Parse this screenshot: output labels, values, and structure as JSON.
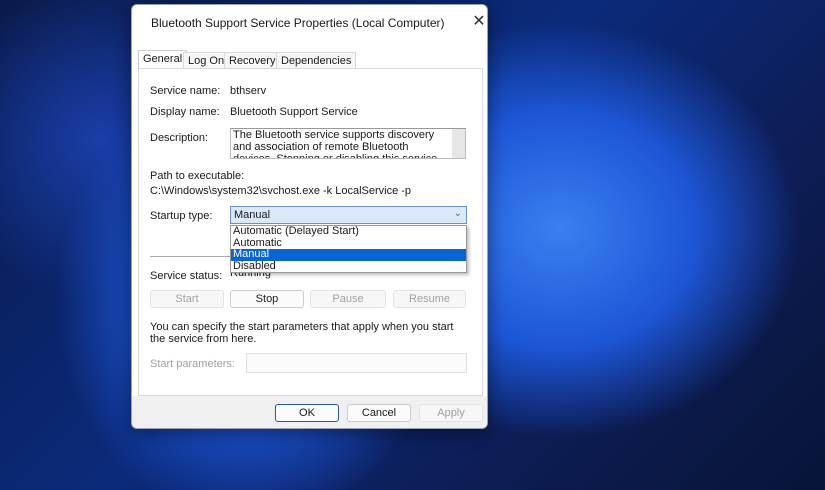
{
  "dialog": {
    "title": "Bluetooth Support Service Properties (Local Computer)",
    "tabs": [
      "General",
      "Log On",
      "Recovery",
      "Dependencies"
    ],
    "service_name_label": "Service name:",
    "service_name": "bthserv",
    "display_name_label": "Display name:",
    "display_name": "Bluetooth Support Service",
    "description_label": "Description:",
    "description": "The Bluetooth service supports discovery and association of remote Bluetooth devices.  Stopping or disabling this service may cause already installed",
    "path_label": "Path to executable:",
    "path": "C:\\Windows\\system32\\svchost.exe -k LocalService -p",
    "startup_label": "Startup type:",
    "startup_value": "Manual",
    "startup_options": [
      "Automatic (Delayed Start)",
      "Automatic",
      "Manual",
      "Disabled"
    ],
    "status_label": "Service status:",
    "status": "Running",
    "buttons": {
      "start": "Start",
      "stop": "Stop",
      "pause": "Pause",
      "resume": "Resume"
    },
    "hint": "You can specify the start parameters that apply when you start the service from here.",
    "params_label": "Start parameters:",
    "params_value": "",
    "footer": {
      "ok": "OK",
      "cancel": "Cancel",
      "apply": "Apply"
    }
  }
}
